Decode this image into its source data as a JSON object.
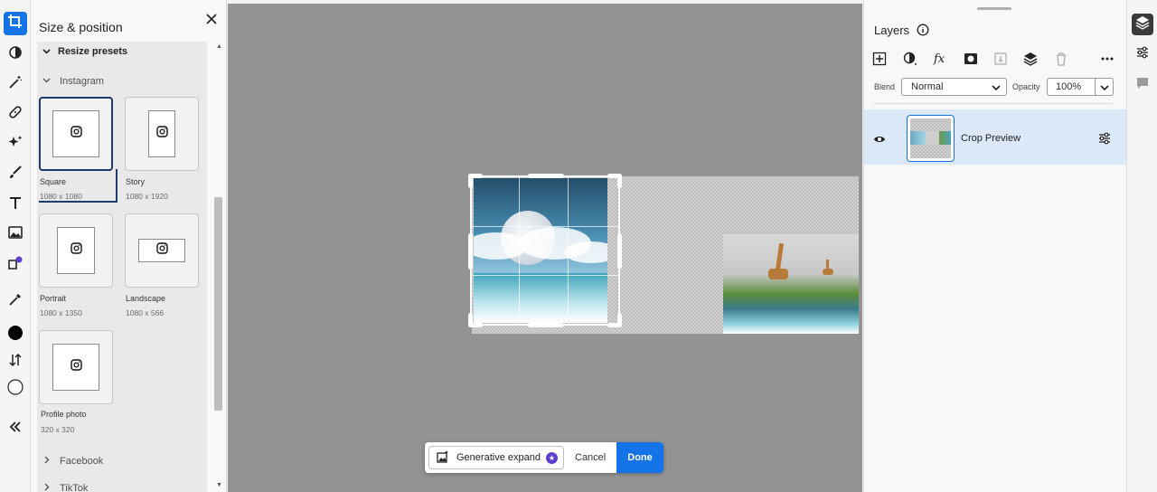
{
  "panel": {
    "title": "Size & position",
    "section": "Resize presets",
    "group_instagram": "Instagram",
    "presets": [
      {
        "name": "Square",
        "size": "1080 x 1080"
      },
      {
        "name": "Story",
        "size": "1080 x 1920"
      },
      {
        "name": "Portrait",
        "size": "1080 x 1350"
      },
      {
        "name": "Landscape",
        "size": "1080 x 566"
      },
      {
        "name": "Profile photo",
        "size": "320 x 320"
      }
    ],
    "group_facebook": "Facebook",
    "group_tiktok": "TikTok"
  },
  "actions": {
    "generative_expand": "Generative expand",
    "cancel": "Cancel",
    "done": "Done"
  },
  "layers": {
    "title": "Layers",
    "blend_label": "Blend",
    "blend_value": "Normal",
    "opacity_label": "Opacity",
    "opacity_value": "100%",
    "layer_name": "Crop Preview"
  },
  "colors": {
    "accent": "#1473e6",
    "premium": "#5c3fd1"
  }
}
